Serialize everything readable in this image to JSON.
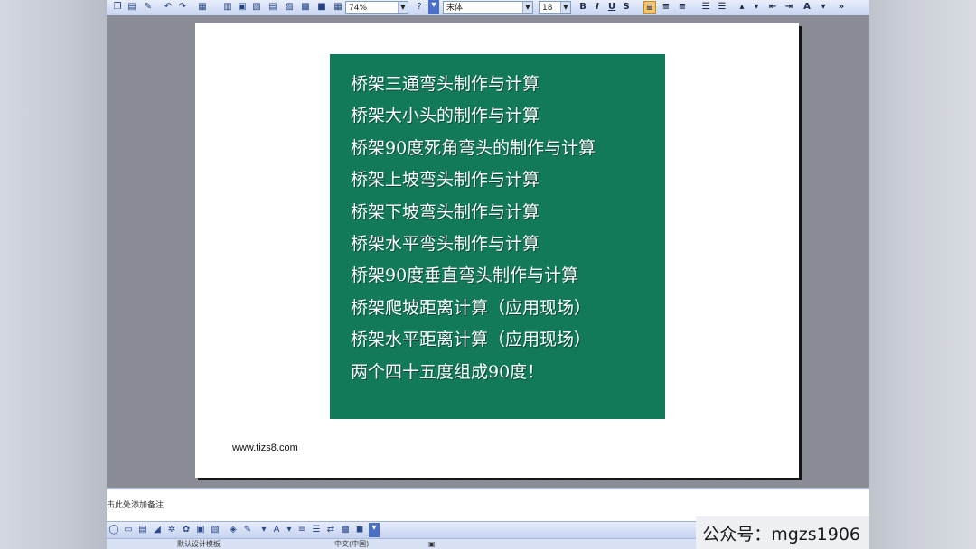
{
  "toolbar": {
    "zoom": "74%",
    "font_name": "宋体",
    "font_size": "18",
    "bold": "B",
    "italic": "I",
    "underline": "U",
    "shadow": "S",
    "font_color_letter": "A"
  },
  "slide": {
    "items": [
      "桥架三通弯头制作与计算",
      "桥架大小头的制作与计算",
      "桥架90度死角弯头的制作与计算",
      "桥架上坡弯头制作与计算",
      "桥架下坡弯头制作与计算",
      "桥架水平弯头制作与计算",
      "桥架90度垂直弯头制作与计算",
      "桥架爬坡距离计算（应用现场）",
      "桥架水平距离计算（应用现场）",
      "两个四十五度组成90度！"
    ],
    "url": "www.tizs8.com",
    "box_color": "#127a5b"
  },
  "notes": {
    "placeholder": "击此处添加备注"
  },
  "statusbar": {
    "design": "默认设计模板",
    "language": "中文(中国)"
  },
  "watermark": "公众号：mgzs1906"
}
